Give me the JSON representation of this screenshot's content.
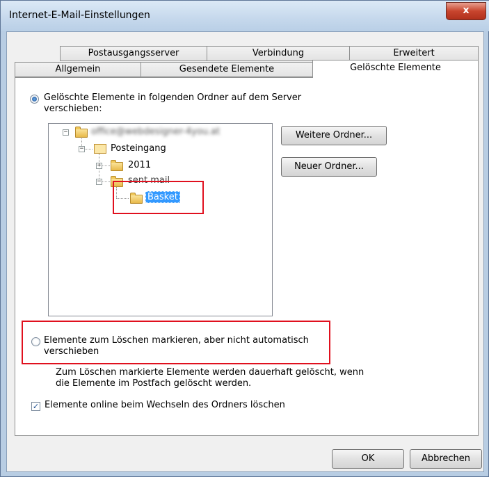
{
  "window": {
    "title": "Internet-E-Mail-Einstellungen",
    "close_label": "x"
  },
  "tabs": {
    "row_back": [
      {
        "label": "Postausgangsserver"
      },
      {
        "label": "Verbindung"
      },
      {
        "label": "Erweitert"
      }
    ],
    "row_front": [
      {
        "label": "Allgemein"
      },
      {
        "label": "Gesendete Elemente"
      },
      {
        "label": "Gelöschte Elemente",
        "active": true
      }
    ]
  },
  "options": {
    "move_radio": {
      "label_line1": "Gelöschte Elemente in folgenden Ordner auf dem Server",
      "label_line2": "verschieben:",
      "selected": true
    },
    "mark_radio": {
      "label_line1": "Elemente zum Löschen markieren, aber nicht automatisch",
      "label_line2": "verschieben",
      "selected": false
    },
    "mark_info": {
      "line1": "Zum Löschen markierte Elemente werden dauerhaft gelöscht, wenn",
      "line2": "die Elemente im Postfach gelöscht werden."
    },
    "online_delete_checkbox": {
      "label": "Elemente online beim Wechseln des Ordners löschen",
      "checked": true
    }
  },
  "tree": {
    "account": {
      "label": "office@webdesigner-4you.at"
    },
    "inbox": {
      "label": "Posteingang"
    },
    "folder_2011": {
      "label": "2011"
    },
    "sent_mail": {
      "label": "sent mail"
    },
    "basket": {
      "label": "Basket"
    }
  },
  "buttons": {
    "more_folders": "Weitere Ordner...",
    "new_folder": "Neuer Ordner...",
    "ok": "OK",
    "cancel": "Abbrechen"
  },
  "colors": {
    "highlight_box": "#e0101e",
    "selection": "#3399ff"
  }
}
